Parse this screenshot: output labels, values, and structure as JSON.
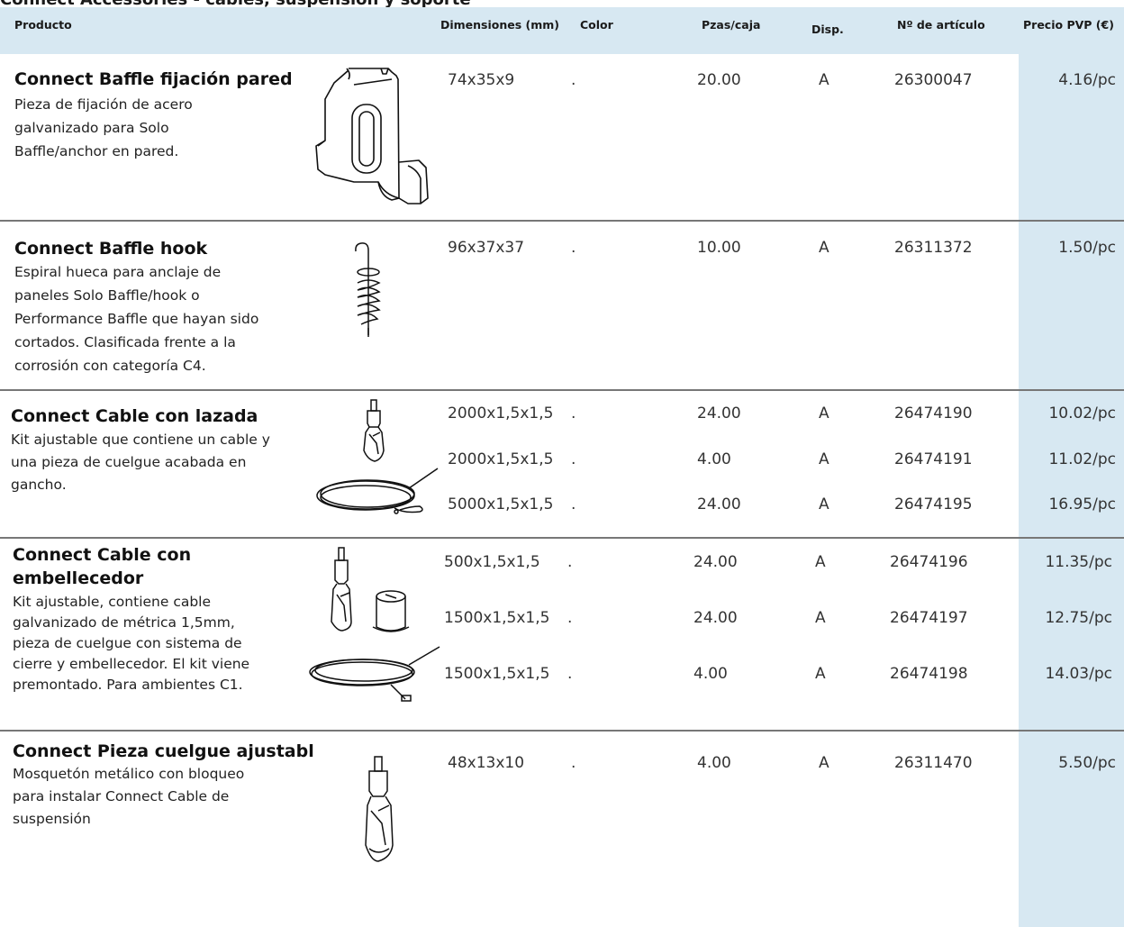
{
  "top_title": "Connect Accessories - cables, suspensión y soporte",
  "columns": {
    "product": "Producto",
    "dimensions": "Dimensiones (mm)",
    "color": "Color",
    "pieces": "Pzas/caja",
    "availability": "Disp.",
    "article": "Nº de artículo",
    "price": "Precio PVP (€)"
  },
  "products": [
    {
      "name": "Connect Baffle fijación pared",
      "description": [
        "Pieza de fijación de acero",
        "galvanizado para Solo",
        "Baffle/anchor en pared."
      ],
      "icon": "wall-bracket-icon",
      "rows": [
        {
          "dimensions": "74x35x9",
          "color": ".",
          "pieces": "20.00",
          "availability": "A",
          "article": "26300047",
          "price": "4.16/pc"
        }
      ]
    },
    {
      "name": "Connect Baffle hook",
      "description": [
        "Espiral hueca para anclaje de",
        "paneles Solo Baffle/hook o",
        "Performance Baffle que hayan sido",
        "cortados. Clasificada frente a la",
        "corrosión con categoría C4."
      ],
      "icon": "spiral-hook-icon",
      "rows": [
        {
          "dimensions": "96x37x37",
          "color": ".",
          "pieces": "10.00",
          "availability": "A",
          "article": "26311372",
          "price": "1.50/pc"
        }
      ]
    },
    {
      "name": "Connect Cable con lazada",
      "description": [
        "Kit ajustable que contiene un cable y",
        "una pieza de cuelgue acabada en",
        "gancho."
      ],
      "icon": "cable-loop-icon",
      "rows": [
        {
          "dimensions": "2000x1,5x1,5",
          "color": ".",
          "pieces": "24.00",
          "availability": "A",
          "article": "26474190",
          "price": "10.02/pc"
        },
        {
          "dimensions": "2000x1,5x1,5",
          "color": ".",
          "pieces": "4.00",
          "availability": "A",
          "article": "26474191",
          "price": "11.02/pc"
        },
        {
          "dimensions": "5000x1,5x1,5",
          "color": ".",
          "pieces": "24.00",
          "availability": "A",
          "article": "26474195",
          "price": "16.95/pc"
        }
      ]
    },
    {
      "name": "Connect Cable con",
      "name_line2": "embellecedor",
      "description": [
        "Kit ajustable, contiene cable",
        "galvanizado de métrica 1,5mm,",
        "pieza de cuelgue con sistema de",
        "cierre y embellecedor. El kit viene",
        "premontado. Para ambientes C1."
      ],
      "icon": "cable-cover-icon",
      "rows": [
        {
          "dimensions": "500x1,5x1,5",
          "color": ".",
          "pieces": "24.00",
          "availability": "A",
          "article": "26474196",
          "price": "11.35/pc"
        },
        {
          "dimensions": "1500x1,5x1,5",
          "color": ".",
          "pieces": "24.00",
          "availability": "A",
          "article": "26474197",
          "price": "12.75/pc"
        },
        {
          "dimensions": "1500x1,5x1,5",
          "color": ".",
          "pieces": "4.00",
          "availability": "A",
          "article": "26474198",
          "price": "14.03/pc"
        }
      ]
    },
    {
      "name": "Connect Pieza cuelgue ajustabl",
      "description": [
        "Mosquetón metálico con bloqueo",
        "para instalar Connect Cable de",
        "suspensión"
      ],
      "icon": "carabiner-icon",
      "rows": [
        {
          "dimensions": "48x13x10",
          "color": ".",
          "pieces": "4.00",
          "availability": "A",
          "article": "26311470",
          "price": "5.50/pc"
        }
      ]
    }
  ],
  "colors": {
    "header_bg": "#d7e8f2",
    "price_bg": "#d7e8f2",
    "divider": "#777777"
  }
}
